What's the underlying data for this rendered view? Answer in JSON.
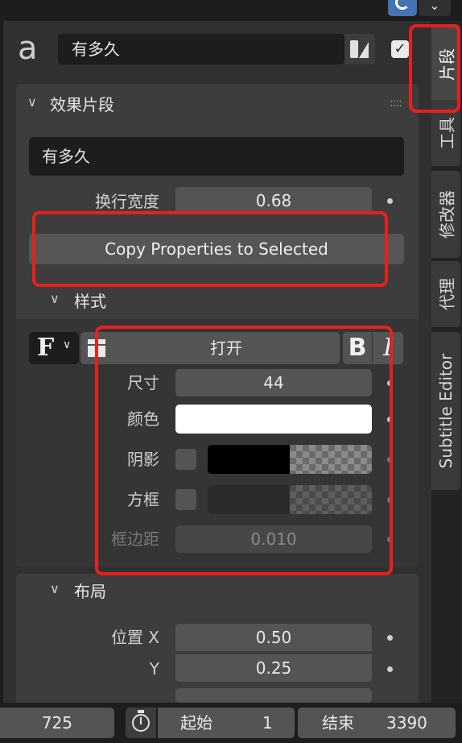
{
  "strip": {
    "type_icon": "a",
    "name": "有多久",
    "enabled": true
  },
  "effect_panel": {
    "title": "效果片段",
    "text_value": "有多久",
    "wrap_width_label": "换行宽度",
    "wrap_width_value": "0.68",
    "copy_button": "Copy Properties to Selected"
  },
  "style_panel": {
    "title": "样式",
    "font_icon": "F",
    "open_label": "打开",
    "bold_label": "B",
    "italic_label": "I",
    "size_label": "尺寸",
    "size_value": "44",
    "color_label": "颜色",
    "color_value": "#ffffff",
    "shadow_label": "阴影",
    "shadow_color": "#000000",
    "box_label": "方框",
    "box_color": "#2b2b2b",
    "box_margin_label": "框边距",
    "box_margin_value": "0.010"
  },
  "layout_panel": {
    "title": "布局",
    "pos_x_label": "位置 X",
    "pos_x_value": "0.50",
    "pos_y_label": "Y",
    "pos_y_value": "0.25"
  },
  "side_tabs": [
    "片段",
    "工具",
    "修改器",
    "代理",
    "Subtitle Editor"
  ],
  "timeline": {
    "current_frame": "725",
    "start_label": "起始",
    "start_value": "1",
    "end_label": "结束",
    "end_value": "3390"
  },
  "colors": {
    "accent": "#4772b3",
    "highlight_red": "#e8201c"
  }
}
